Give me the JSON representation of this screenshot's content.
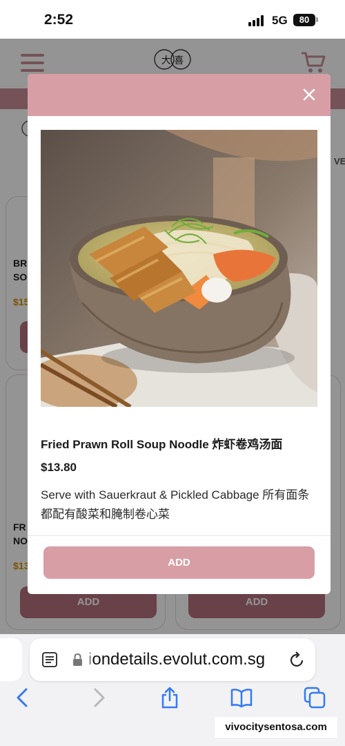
{
  "status_bar": {
    "time": "2:52",
    "network": "5G",
    "battery": "80"
  },
  "page": {
    "logo_text": "大 喜",
    "category_more": "VE",
    "cards": [
      {
        "name": "BR\nSO",
        "price": "$15"
      },
      {
        "name": "FR\nNO",
        "price": "$13",
        "button": "ADD"
      },
      {
        "button": "ADD"
      }
    ]
  },
  "modal": {
    "title": "Fried Prawn Roll Soup Noodle 炸虾卷鸡汤面",
    "price": "$13.80",
    "description": "Serve with Sauerkraut & Pickled Cabbage 所有面条都配有酸菜和腌制卷心菜",
    "add_label": "ADD"
  },
  "browser": {
    "url_prefix": "i",
    "url": "ondetails.evolut.com.sg"
  },
  "watermark": "vivocitysentosa.com",
  "colors": {
    "accent": "#d89ea6",
    "dark_accent": "#b5707d",
    "price": "#d69200",
    "link": "#3478f6"
  },
  "icons": [
    "hamburger-icon",
    "cart-icon",
    "close-icon",
    "reader-icon",
    "lock-icon",
    "reload-icon",
    "back-icon",
    "forward-icon",
    "share-icon",
    "bookmarks-icon",
    "tabs-icon"
  ]
}
